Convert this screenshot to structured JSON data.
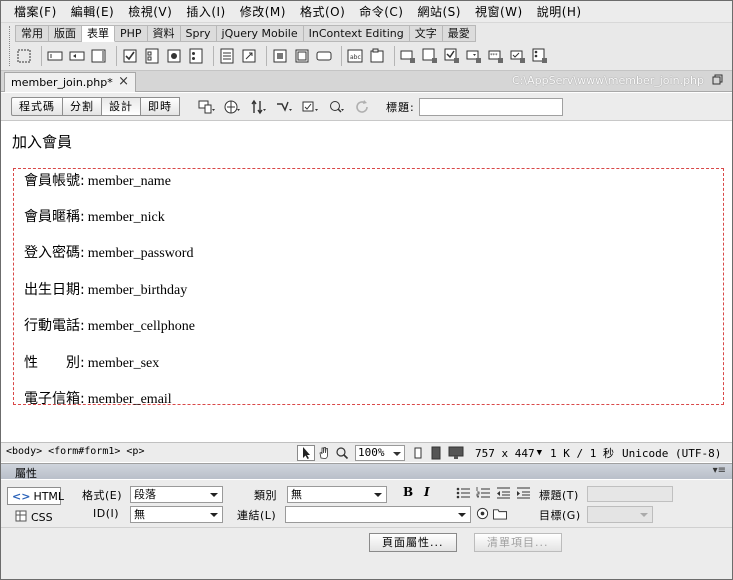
{
  "menubar": [
    "檔案(F)",
    "編輯(E)",
    "檢視(V)",
    "插入(I)",
    "修改(M)",
    "格式(O)",
    "命令(C)",
    "網站(S)",
    "視窗(W)",
    "說明(H)"
  ],
  "insert_panel": {
    "tabs": [
      {
        "label": "常用",
        "active": false
      },
      {
        "label": "版面",
        "active": false
      },
      {
        "label": "表單",
        "active": true
      },
      {
        "label": "PHP",
        "active": false
      },
      {
        "label": "資料",
        "active": false
      },
      {
        "label": "Spry",
        "active": false
      },
      {
        "label": "jQuery Mobile",
        "active": false
      },
      {
        "label": "InContext Editing",
        "active": false
      },
      {
        "label": "文字",
        "active": false
      },
      {
        "label": "最愛",
        "active": false
      }
    ]
  },
  "document": {
    "tab_name": "member_join.php*",
    "close_glyph": "×",
    "path": "C:\\AppServ\\www\\member_join.php"
  },
  "doc_toolbar": {
    "view_buttons": [
      "程式碼",
      "分割",
      "設計",
      "即時"
    ],
    "title_label": "標題:",
    "title_value": ""
  },
  "canvas": {
    "heading": "加入會員",
    "fields": [
      {
        "label": "會員帳號:",
        "name": "member_name"
      },
      {
        "label": "會員暱稱:",
        "name": "member_nick"
      },
      {
        "label": "登入密碼:",
        "name": "member_password"
      },
      {
        "label": "出生日期:",
        "name": "member_birthday"
      },
      {
        "label": "行動電話:",
        "name": "member_cellphone"
      },
      {
        "label": "性　　別:",
        "name": "member_sex"
      },
      {
        "label": "電子信箱:",
        "name": "member_email"
      }
    ]
  },
  "statusbar": {
    "tag_selector": "<body> <form#form1> <p>",
    "zoom": "100%",
    "window_size": "757 x 447",
    "download": "1 K / 1 秒",
    "encoding": "Unicode (UTF-8)"
  },
  "properties": {
    "panel_title": "屬性",
    "html_label": "HTML",
    "css_label": "CSS",
    "format_label": "格式(E)",
    "format_value": "段落",
    "id_label": "ID(I)",
    "id_value": "無",
    "class_label": "類別",
    "class_value": "無",
    "link_label": "連結(L)",
    "link_value": "",
    "title_label": "標題(T)",
    "target_label": "目標(G)",
    "bold": "B",
    "italic": "I",
    "page_props_button": "頁面屬性...",
    "list_item_button": "清單項目..."
  },
  "colors": {
    "form_border": "#d94848",
    "accent_blue": "#2a62b8"
  }
}
